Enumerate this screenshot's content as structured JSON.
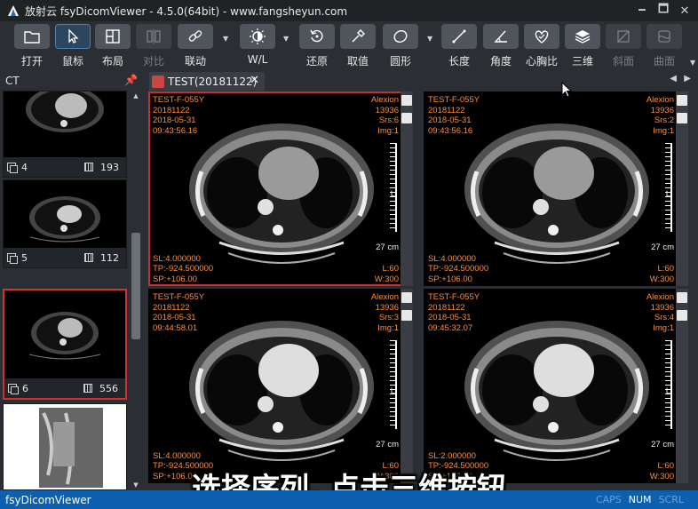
{
  "window": {
    "title": "放射云 fsyDicomViewer - 4.5.0(64bit) - www.fangsheyun.com",
    "controls": [
      "🗕",
      "🗖",
      "✕"
    ]
  },
  "toolbar": {
    "tools": [
      {
        "label": "打开",
        "icon": "folder-icon"
      },
      {
        "label": "鼠标",
        "icon": "cursor-arrow-icon",
        "active": true
      },
      {
        "label": "布局",
        "icon": "layout-grid-icon"
      },
      {
        "label": "对比",
        "icon": "compare-icon",
        "disabled": true
      },
      {
        "label": "联动",
        "icon": "link-icon"
      },
      {
        "label": "W/L",
        "icon": "window-level-icon",
        "dropdown": true
      },
      {
        "label": "还原",
        "icon": "reset-icon"
      },
      {
        "label": "取值",
        "icon": "eyedropper-icon"
      },
      {
        "label": "圆形",
        "icon": "ellipse-icon",
        "dropdown": true
      },
      {
        "label": "长度",
        "icon": "ruler-length-icon"
      },
      {
        "label": "角度",
        "icon": "angle-icon"
      },
      {
        "label": "心胸比",
        "icon": "heart-ratio-icon"
      },
      {
        "label": "三维",
        "icon": "3d-layers-icon"
      },
      {
        "label": "斜面",
        "icon": "oblique-plane-icon",
        "disabled": true
      },
      {
        "label": "曲面",
        "icon": "curved-plane-icon",
        "disabled": true
      }
    ]
  },
  "series_panel": {
    "modality": "CT",
    "items": [
      {
        "number": "4",
        "count": "193"
      },
      {
        "number": "5",
        "count": "112"
      },
      {
        "number": "6",
        "count": "556",
        "selected": true
      },
      {
        "number": "",
        "count": ""
      }
    ]
  },
  "tab": {
    "label": "TEST(20181122)"
  },
  "viewports": [
    {
      "patient": "TEST-F-055Y",
      "date_id": "20181122",
      "study_date": "2018-05-31",
      "time": "09:43:56.16",
      "mfr": "Alexion",
      "num": "13936",
      "srs": "Srs:6",
      "img": "Img:1",
      "sl": "SL:4.000000",
      "tp": "TP:-924.500000",
      "sp": "SP:+106.00",
      "wl": "L:60",
      "ww": "W:300",
      "scale": "27 cm",
      "orient": "L"
    },
    {
      "patient": "TEST-F-055Y",
      "date_id": "20181122",
      "study_date": "2018-05-31",
      "time": "09:43:56.16",
      "mfr": "Alexion",
      "num": "13936",
      "srs": "Srs:2",
      "img": "Img:1",
      "sl": "SL:4.000000",
      "tp": "TP:-924.500000",
      "sp": "SP:+106.00",
      "wl": "L:60",
      "ww": "W:300",
      "scale": "27 cm",
      "orient": "L"
    },
    {
      "patient": "TEST-F-055Y",
      "date_id": "20181122",
      "study_date": "2018-05-31",
      "time": "09:44:58.01",
      "mfr": "Alexion",
      "num": "13936",
      "srs": "Srs:3",
      "img": "Img:1",
      "sl": "SL:4.000000",
      "tp": "TP:-924.500000",
      "sp": "SP:+106.00",
      "wl": "L:60",
      "ww": "W:300",
      "scale": "27 cm",
      "orient": "L"
    },
    {
      "patient": "TEST-F-055Y",
      "date_id": "20181122",
      "study_date": "2018-05-31",
      "time": "09:45:32.07",
      "mfr": "Alexion",
      "num": "13936",
      "srs": "Srs:4",
      "img": "Img:1",
      "sl": "SL:2.000000",
      "tp": "TP:-924.500000",
      "sp": "SP:+106.00",
      "wl": "L:60",
      "ww": "W:300",
      "scale": "27 cm",
      "orient": "L"
    }
  ],
  "caption": "选择序列, 点击三维按钮",
  "statusbar": {
    "app_name": "fsyDicomViewer",
    "caps": "CAPS",
    "num": "NUM",
    "scrl": "SCRL"
  }
}
